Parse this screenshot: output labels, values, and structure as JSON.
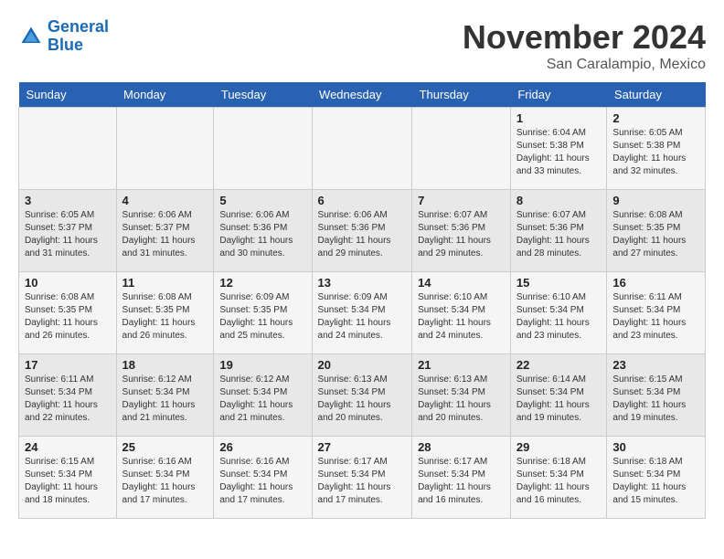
{
  "header": {
    "logo_line1": "General",
    "logo_line2": "Blue",
    "month_title": "November 2024",
    "location": "San Caralampio, Mexico"
  },
  "weekdays": [
    "Sunday",
    "Monday",
    "Tuesday",
    "Wednesday",
    "Thursday",
    "Friday",
    "Saturday"
  ],
  "weeks": [
    [
      {
        "day": "",
        "info": ""
      },
      {
        "day": "",
        "info": ""
      },
      {
        "day": "",
        "info": ""
      },
      {
        "day": "",
        "info": ""
      },
      {
        "day": "",
        "info": ""
      },
      {
        "day": "1",
        "info": "Sunrise: 6:04 AM\nSunset: 5:38 PM\nDaylight: 11 hours and 33 minutes."
      },
      {
        "day": "2",
        "info": "Sunrise: 6:05 AM\nSunset: 5:38 PM\nDaylight: 11 hours and 32 minutes."
      }
    ],
    [
      {
        "day": "3",
        "info": "Sunrise: 6:05 AM\nSunset: 5:37 PM\nDaylight: 11 hours and 31 minutes."
      },
      {
        "day": "4",
        "info": "Sunrise: 6:06 AM\nSunset: 5:37 PM\nDaylight: 11 hours and 31 minutes."
      },
      {
        "day": "5",
        "info": "Sunrise: 6:06 AM\nSunset: 5:36 PM\nDaylight: 11 hours and 30 minutes."
      },
      {
        "day": "6",
        "info": "Sunrise: 6:06 AM\nSunset: 5:36 PM\nDaylight: 11 hours and 29 minutes."
      },
      {
        "day": "7",
        "info": "Sunrise: 6:07 AM\nSunset: 5:36 PM\nDaylight: 11 hours and 29 minutes."
      },
      {
        "day": "8",
        "info": "Sunrise: 6:07 AM\nSunset: 5:36 PM\nDaylight: 11 hours and 28 minutes."
      },
      {
        "day": "9",
        "info": "Sunrise: 6:08 AM\nSunset: 5:35 PM\nDaylight: 11 hours and 27 minutes."
      }
    ],
    [
      {
        "day": "10",
        "info": "Sunrise: 6:08 AM\nSunset: 5:35 PM\nDaylight: 11 hours and 26 minutes."
      },
      {
        "day": "11",
        "info": "Sunrise: 6:08 AM\nSunset: 5:35 PM\nDaylight: 11 hours and 26 minutes."
      },
      {
        "day": "12",
        "info": "Sunrise: 6:09 AM\nSunset: 5:35 PM\nDaylight: 11 hours and 25 minutes."
      },
      {
        "day": "13",
        "info": "Sunrise: 6:09 AM\nSunset: 5:34 PM\nDaylight: 11 hours and 24 minutes."
      },
      {
        "day": "14",
        "info": "Sunrise: 6:10 AM\nSunset: 5:34 PM\nDaylight: 11 hours and 24 minutes."
      },
      {
        "day": "15",
        "info": "Sunrise: 6:10 AM\nSunset: 5:34 PM\nDaylight: 11 hours and 23 minutes."
      },
      {
        "day": "16",
        "info": "Sunrise: 6:11 AM\nSunset: 5:34 PM\nDaylight: 11 hours and 23 minutes."
      }
    ],
    [
      {
        "day": "17",
        "info": "Sunrise: 6:11 AM\nSunset: 5:34 PM\nDaylight: 11 hours and 22 minutes."
      },
      {
        "day": "18",
        "info": "Sunrise: 6:12 AM\nSunset: 5:34 PM\nDaylight: 11 hours and 21 minutes."
      },
      {
        "day": "19",
        "info": "Sunrise: 6:12 AM\nSunset: 5:34 PM\nDaylight: 11 hours and 21 minutes."
      },
      {
        "day": "20",
        "info": "Sunrise: 6:13 AM\nSunset: 5:34 PM\nDaylight: 11 hours and 20 minutes."
      },
      {
        "day": "21",
        "info": "Sunrise: 6:13 AM\nSunset: 5:34 PM\nDaylight: 11 hours and 20 minutes."
      },
      {
        "day": "22",
        "info": "Sunrise: 6:14 AM\nSunset: 5:34 PM\nDaylight: 11 hours and 19 minutes."
      },
      {
        "day": "23",
        "info": "Sunrise: 6:15 AM\nSunset: 5:34 PM\nDaylight: 11 hours and 19 minutes."
      }
    ],
    [
      {
        "day": "24",
        "info": "Sunrise: 6:15 AM\nSunset: 5:34 PM\nDaylight: 11 hours and 18 minutes."
      },
      {
        "day": "25",
        "info": "Sunrise: 6:16 AM\nSunset: 5:34 PM\nDaylight: 11 hours and 17 minutes."
      },
      {
        "day": "26",
        "info": "Sunrise: 6:16 AM\nSunset: 5:34 PM\nDaylight: 11 hours and 17 minutes."
      },
      {
        "day": "27",
        "info": "Sunrise: 6:17 AM\nSunset: 5:34 PM\nDaylight: 11 hours and 17 minutes."
      },
      {
        "day": "28",
        "info": "Sunrise: 6:17 AM\nSunset: 5:34 PM\nDaylight: 11 hours and 16 minutes."
      },
      {
        "day": "29",
        "info": "Sunrise: 6:18 AM\nSunset: 5:34 PM\nDaylight: 11 hours and 16 minutes."
      },
      {
        "day": "30",
        "info": "Sunrise: 6:18 AM\nSunset: 5:34 PM\nDaylight: 11 hours and 15 minutes."
      }
    ]
  ]
}
